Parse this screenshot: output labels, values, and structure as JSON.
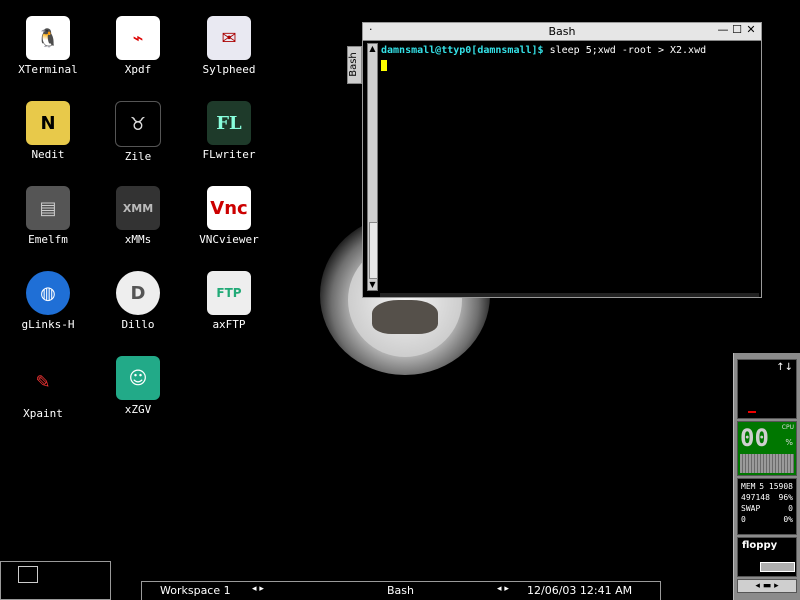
{
  "desktop_icons": [
    {
      "label": "XTerminal",
      "icon": "tux-icon"
    },
    {
      "label": "Xpdf",
      "icon": "pdf-icon"
    },
    {
      "label": "Sylpheed",
      "icon": "mail-icon"
    },
    {
      "label": "Nedit",
      "icon": "editor-icon"
    },
    {
      "label": "Zile",
      "icon": "gnu-icon"
    },
    {
      "label": "FLwriter",
      "icon": "flwriter-icon"
    },
    {
      "label": "Emelfm",
      "icon": "file-cabinet-icon"
    },
    {
      "label": "xMMs",
      "icon": "xmms-icon"
    },
    {
      "label": "VNCviewer",
      "icon": "vnc-icon"
    },
    {
      "label": "gLinks-H",
      "icon": "globe-icon"
    },
    {
      "label": "Dillo",
      "icon": "dillo-icon"
    },
    {
      "label": "axFTP",
      "icon": "ftp-icon"
    },
    {
      "label": "Xpaint",
      "icon": "paint-icon"
    },
    {
      "label": "xZGV",
      "icon": "image-viewer-icon"
    }
  ],
  "window": {
    "title": "Bash",
    "tab_label": "Bash",
    "menu_dot": "·",
    "controls": {
      "minimize": "—",
      "maximize": "☐",
      "close": "✕"
    },
    "prompt": "damnsmall@ttyp0[damnsmall]$",
    "command": " sleep 5;xwd -root > X2.xwd"
  },
  "taskbar": {
    "workspace": "Workspace 1",
    "ws_arrows": "◂ ▸",
    "task": "Bash",
    "clock_arrows": "◂ ▸",
    "clock": "12/06/03 12:41 AM"
  },
  "dock": {
    "arrows": "↑↓",
    "cpu_digits": "00",
    "cpu_label": "CPU",
    "cpu_pct": "%",
    "mem_label": "MEM",
    "mem_value": "5 15908",
    "mem_line2_a": "497148",
    "mem_line2_b": "96%",
    "swap_label": "SWAP",
    "swap_value": "0",
    "line4_a": "0",
    "line4_b": "0%",
    "floppy_label": "floppy"
  }
}
